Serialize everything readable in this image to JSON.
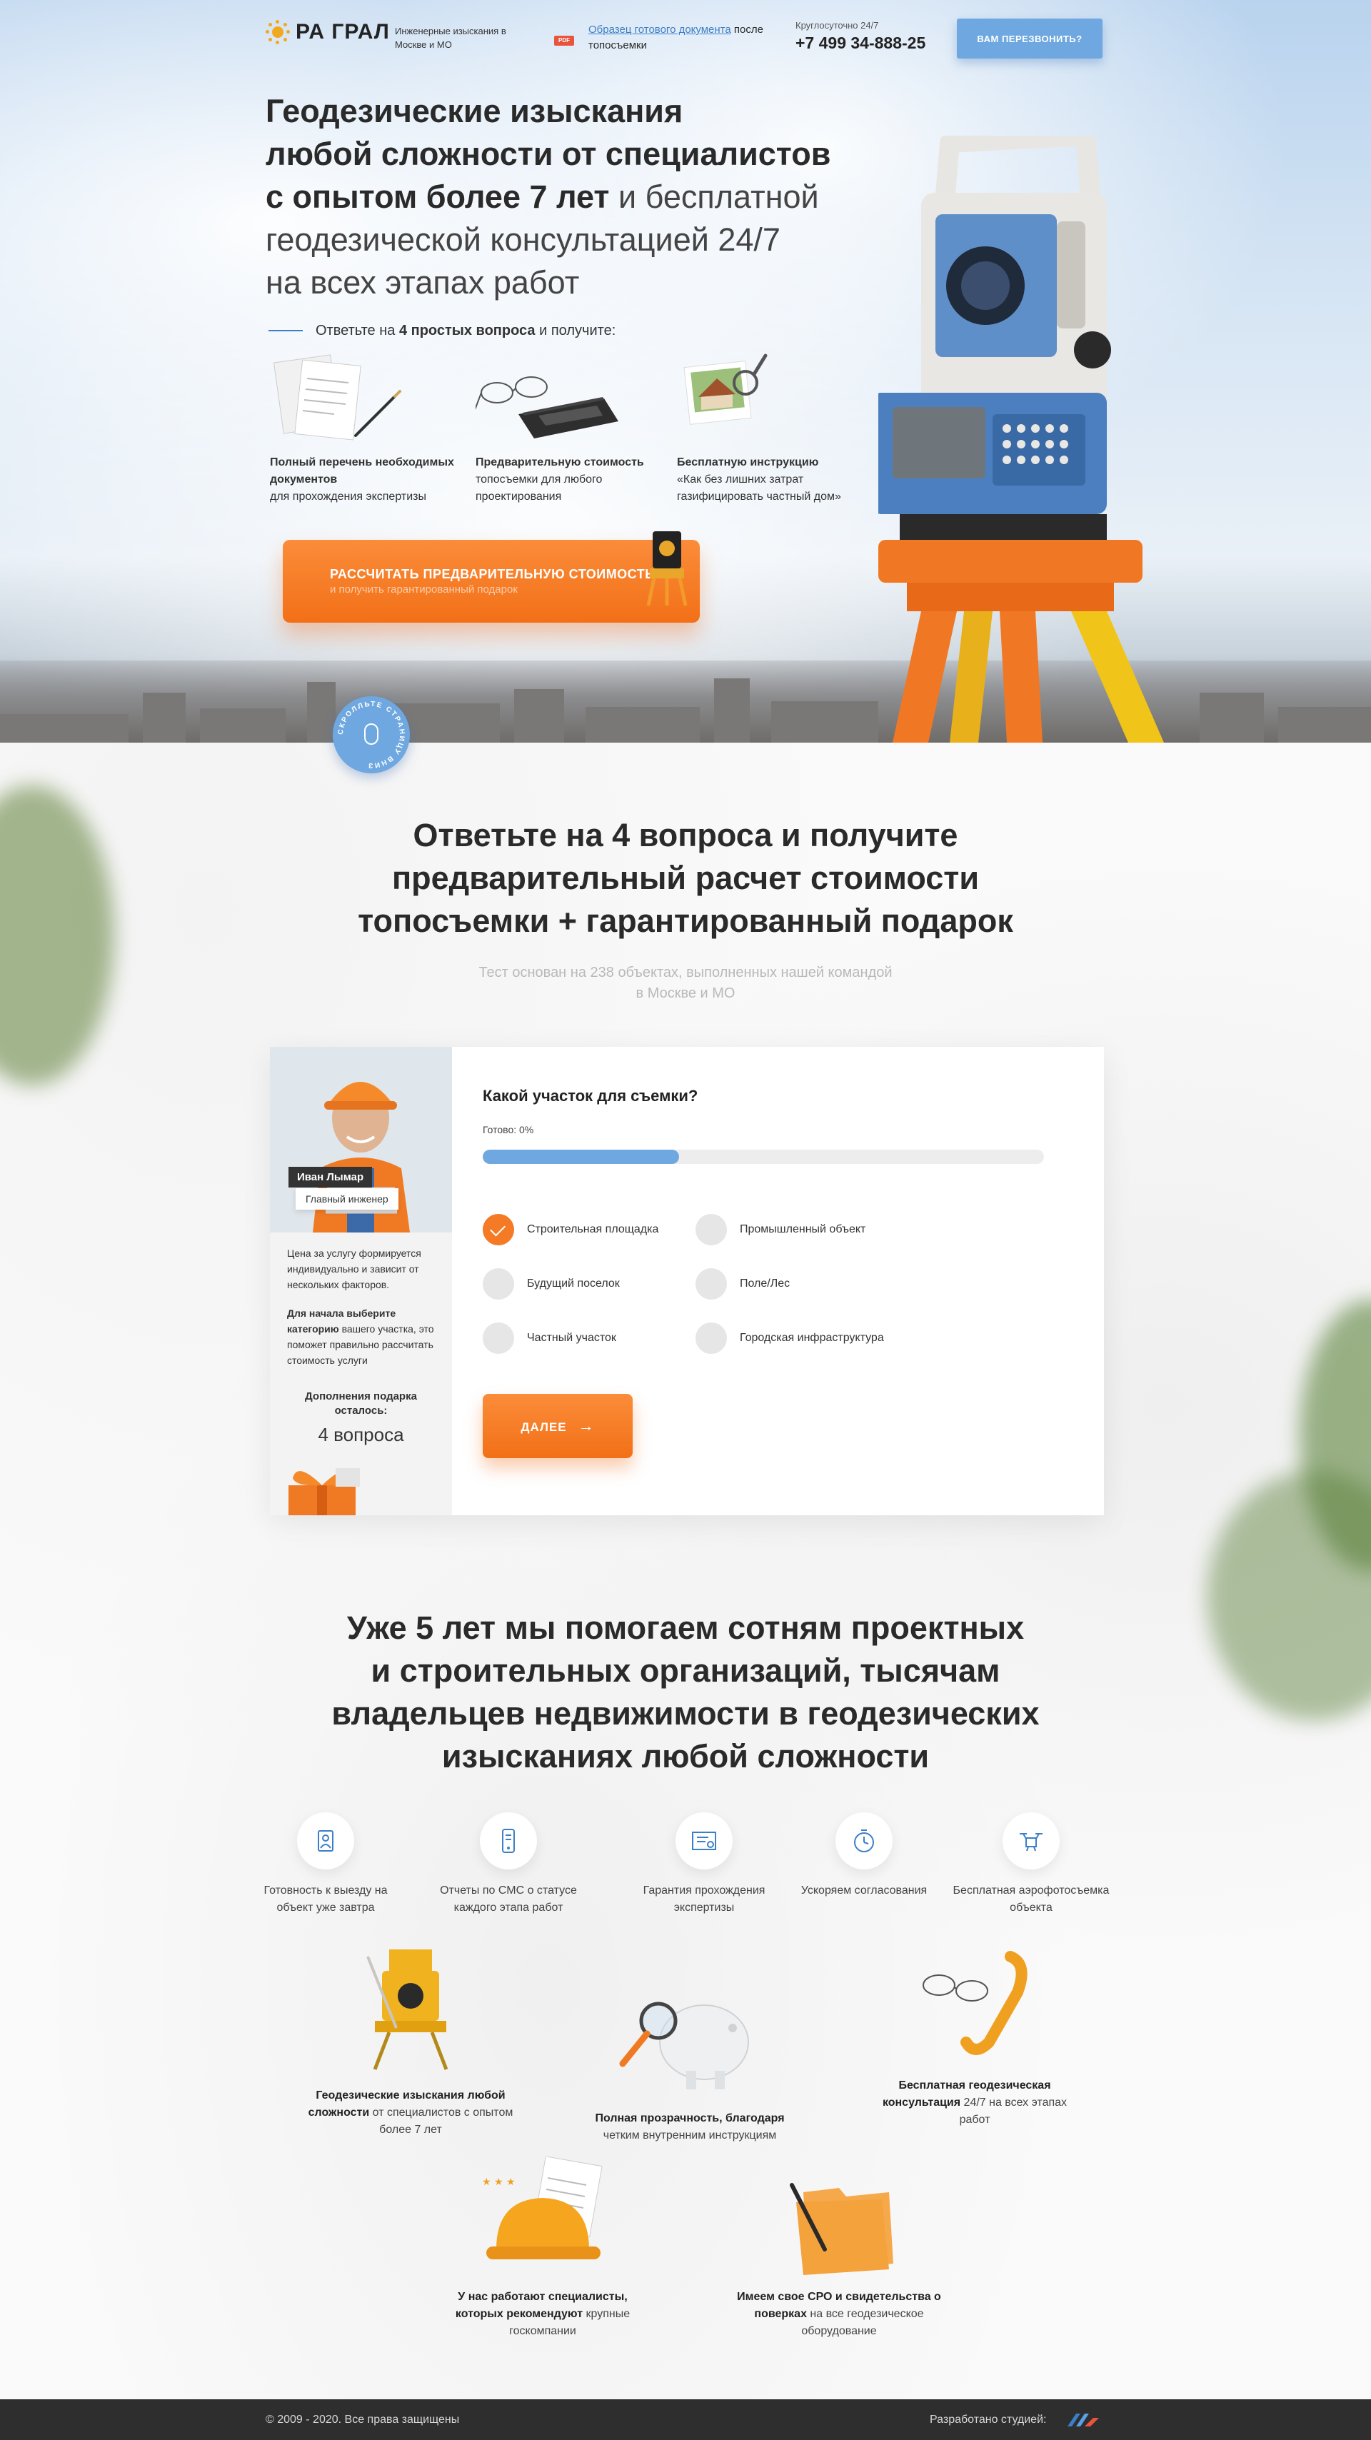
{
  "header": {
    "logo_text": "РА ГРАЛ",
    "tagline": "Инженерные изыскания в Москве и МО",
    "pdf_badge": "PDF",
    "sample_link": "Образец готового документа",
    "sample_suffix": "после топосъемки",
    "phone_label": "Круглосуточно 24/7",
    "phone": "+7 499 34-888-25",
    "callback_button": "ВАМ ПЕРЕЗВОНИТЬ?"
  },
  "hero": {
    "title_bold_1": "Геодезические изыскания",
    "title_bold_2": "любой сложности от специалистов",
    "title_bold_3": "с опытом более 7 лет",
    "title_light_3": " и бесплатной",
    "title_light_4": "геодезической консультацией 24/7",
    "title_light_5": "на всех этапах работ",
    "questions_prefix": "Ответьте на",
    "questions_bold": "4 простых вопроса",
    "questions_suffix": "и получите:",
    "bonuses": [
      {
        "bold": "Полный перечень необходимых документов",
        "text": "для прохождения экспертизы"
      },
      {
        "bold": "Предварительную стоимость",
        "text": "топосъемки для любого проектирования"
      },
      {
        "bold": "Бесплатную инструкцию",
        "text": "«Как без лишних затрат газифицировать частный дом»"
      }
    ],
    "cta_main": "РАССЧИТАТЬ ПРЕДВАРИТЕЛЬНУЮ СТОИМОСТЬ",
    "cta_sub": "и получить гарантированный подарок",
    "scroll_text": "СКРОЛЛЬТЕ СТРАНИЦУ ВНИЗ"
  },
  "quiz_section": {
    "title_light_1": "Ответьте на 4 вопроса и получите",
    "title_bold_2": "предварительный расчет стоимости",
    "title_bold_3": "топосъемки",
    "title_light_3": " + гарантированный подарок",
    "subtitle_1": "Тест основан на 238 объектах, выполненных нашей командой",
    "subtitle_2": "в Москве и МО"
  },
  "quiz": {
    "engineer_name": "Иван Лымар",
    "engineer_role": "Главный инженер",
    "side_text_1": "Цена за услугу формируется индивидуально и зависит от нескольких факторов.",
    "side_text_2_bold": "Для начала выберите категорию",
    "side_text_2": " вашего участка, это поможет правильно рассчитать стоимость услуги",
    "gift_label": "Дополнения подарка осталось:",
    "gift_count": "4 вопроса",
    "question": "Какой участок для съемки?",
    "ready_label": "Готово: 0%",
    "progress": 0.35,
    "options": [
      {
        "label": "Строительная площадка",
        "selected": true
      },
      {
        "label": "Промышленный объект",
        "selected": false
      },
      {
        "label": "Будущий поселок",
        "selected": false
      },
      {
        "label": "Поле/Лес",
        "selected": false
      },
      {
        "label": "Частный участок",
        "selected": false
      },
      {
        "label": "Городская инфраструктура",
        "selected": false
      }
    ],
    "next_button": "ДАЛЕЕ"
  },
  "about": {
    "title_light_1": "Уже 5 лет мы помогаем ",
    "title_bold_1": "сотням проектных",
    "title_bold_2": "и строительных организаций, тысячам",
    "title_bold_3": "владельцев недвижимости",
    "title_light_3": " в геодезических",
    "title_light_4": "изысканиях любой сложности",
    "features": [
      {
        "icon": "worker-icon",
        "text": "Готовность к выезду на объект уже завтра"
      },
      {
        "icon": "phone-report-icon",
        "text": "Отчеты по СМС о статусе каждого этапа работ"
      },
      {
        "icon": "certificate-icon",
        "text": "Гарантия прохождения экспертизы"
      },
      {
        "icon": "stopwatch-icon",
        "text": "Ускоряем согласования"
      },
      {
        "icon": "drone-icon",
        "text": "Бесплатная аэрофотосъемка объекта"
      }
    ],
    "advantages": [
      {
        "bold": "Геодезические изыскания любой сложности",
        "text": " от специалистов с опытом более 7 лет"
      },
      {
        "bold": "Полная прозрачность, благодаря",
        "text": " четким внутренним инструкциям"
      },
      {
        "bold": "Бесплатная геодезическая консультация",
        "text": " 24/7 на всех этапах работ"
      },
      {
        "bold": "У нас работают специалисты, которых рекомендуют",
        "text": " крупные госкомпании"
      },
      {
        "bold": "Имеем свое СРО и свидетельства о поверках",
        "text": " на все геодезическое оборудование"
      }
    ]
  },
  "footer": {
    "copyright": "© 2009 - 2020. Все права защищены",
    "developer": "Разработано студией:"
  },
  "colors": {
    "accent_orange": "#f47a25",
    "accent_blue": "#6fa8e0",
    "link_blue": "#3b7fc7",
    "footer_bg": "#2e2e2e"
  }
}
